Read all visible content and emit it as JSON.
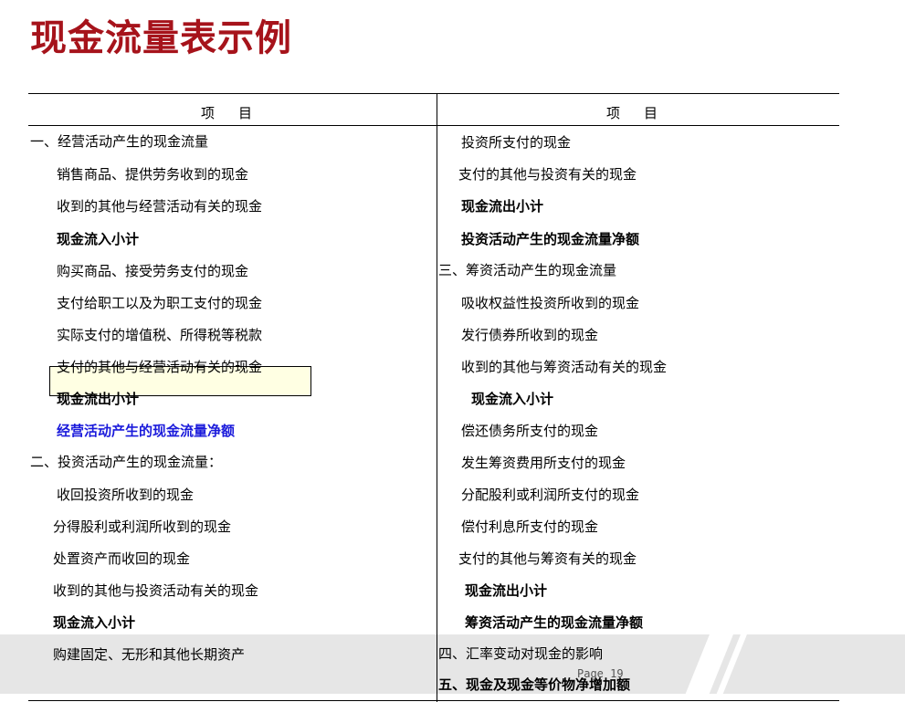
{
  "title": "现金流量表示例",
  "header": {
    "left": "项目",
    "right": "项目"
  },
  "footer": {
    "page": "Page 19"
  },
  "left_rows": [
    "一、经营活动产生的现金流量",
    "销售商品、提供劳务收到的现金",
    "收到的其他与经营活动有关的现金",
    "现金流入小计",
    "购买商品、接受劳务支付的现金",
    "支付给职工以及为职工支付的现金",
    "实际支付的增值税、所得税等税款",
    "支付的其他与经营活动有关的现金",
    "现金流出小计",
    "经营活动产生的现金流量净额",
    "二、投资活动产生的现金流量：",
    "收回投资所收到的现金",
    "分得股利或利润所收到的现金",
    "处置资产而收回的现金",
    "收到的其他与投资活动有关的现金",
    "现金流入小计",
    "购建固定、无形和其他长期资产"
  ],
  "right_rows": [
    "投资所支付的现金",
    "支付的其他与投资有关的现金",
    "现金流出小计",
    "投资活动产生的现金流量净额",
    "三、筹资活动产生的现金流量",
    "吸收权益性投资所收到的现金",
    "发行债券所收到的现金",
    "收到的其他与筹资活动有关的现金",
    "现金流入小计",
    "偿还债务所支付的现金",
    "发生筹资费用所支付的现金",
    "分配股利或利润所支付的现金",
    "偿付利息所支付的现金",
    "支付的其他与筹资有关的现金",
    "现金流出小计",
    "筹资活动产生的现金流量净额",
    "四、汇率变动对现金的影响",
    "五、现金及现金等价物净增加额"
  ],
  "colors": {
    "title": "#a6131b",
    "highlight": "#1a1adb"
  }
}
